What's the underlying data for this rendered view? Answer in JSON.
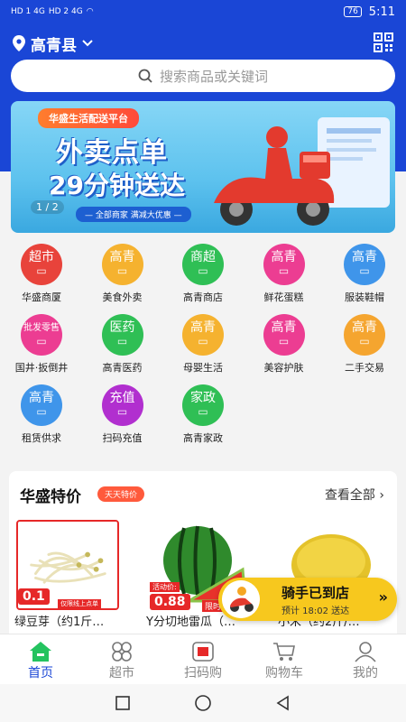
{
  "status_bar": {
    "signal_left": "HD 1 4G",
    "signal_right": "HD 2 4G",
    "battery": "76",
    "time": "5:11"
  },
  "header": {
    "location": "高青县"
  },
  "search": {
    "placeholder": "搜索商品或关键词"
  },
  "banner": {
    "platform": "华盛生活配送平台",
    "headline1": "外卖点单",
    "headline2": "29分钟送达",
    "promo": "— 全部商家  满减大优惠 —",
    "pager": "1 / 2"
  },
  "categories": [
    {
      "icon_text": "超市",
      "label": "华盛商厦",
      "color": "#e8433b"
    },
    {
      "icon_text": "高青",
      "label": "美食外卖",
      "color": "#f5b22f"
    },
    {
      "icon_text": "商超",
      "label": "高青商店",
      "color": "#2fbf55"
    },
    {
      "icon_text": "高青",
      "label": "鲜花蛋糕",
      "color": "#ec3d92"
    },
    {
      "icon_text": "高青",
      "label": "服装鞋帽",
      "color": "#3f95ea"
    },
    {
      "icon_text": "批发零售",
      "label": "国井·扳倒井",
      "color": "#ec3d92"
    },
    {
      "icon_text": "医药",
      "label": "高青医药",
      "color": "#2fbf55"
    },
    {
      "icon_text": "高青",
      "label": "母婴生活",
      "color": "#f5b22f"
    },
    {
      "icon_text": "高青",
      "label": "美容护肤",
      "color": "#ec3d92"
    },
    {
      "icon_text": "高青",
      "label": "二手交易",
      "color": "#f5a52f"
    },
    {
      "icon_text": "高青",
      "label": "租赁供求",
      "color": "#3f95ea"
    },
    {
      "icon_text": "充值",
      "label": "扫码充值",
      "color": "#b12fcf"
    },
    {
      "icon_text": "家政",
      "label": "高青家政",
      "color": "#2fbf55"
    }
  ],
  "special": {
    "title": "华盛特价",
    "tag": "天天特价",
    "view_all": "查看全部 ›",
    "products": [
      {
        "name": "绿豆芽（约1斤…",
        "price": "0.1",
        "badge": "仅限线上点单"
      },
      {
        "name": "Y分切地雷瓜（…",
        "price": "0.88",
        "badge": "活动价:",
        "badge2": "限时"
      },
      {
        "name": "小米（约2斤/…",
        "price": "",
        "badge": ""
      }
    ]
  },
  "rider": {
    "status": "骑手已到店",
    "eta": "预计 18:02 送达",
    "arrow": "»"
  },
  "tabs": [
    {
      "label": "首页",
      "active": true
    },
    {
      "label": "超市",
      "active": false
    },
    {
      "label": "扫码购",
      "active": false
    },
    {
      "label": "购物车",
      "active": false
    },
    {
      "label": "我的",
      "active": false
    }
  ]
}
